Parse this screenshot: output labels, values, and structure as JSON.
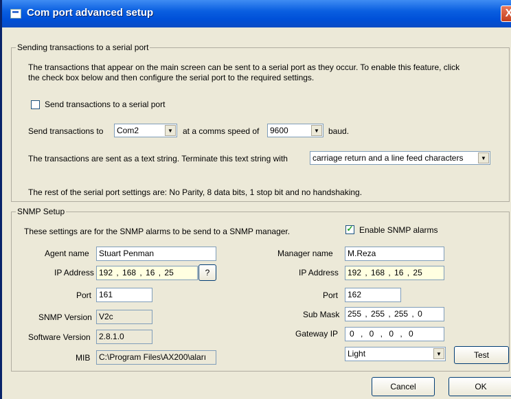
{
  "window": {
    "title": "Com port advanced setup",
    "close_glyph": "X"
  },
  "serial": {
    "legend": "Sending transactions to a serial port",
    "description_line1": "The transactions that appear on the main screen can be sent to a serial port as they occur. To enable this feature, click",
    "description_line2": "the check box below and then configure the serial port to the required settings.",
    "checkbox_label": "Send transactions to a serial port",
    "checkbox_checked": false,
    "send_to_label": "Send transactions to",
    "port_value": "Com2",
    "speed_label": "at a comms speed of",
    "speed_value": "9600",
    "baud_label": "baud.",
    "terminate_label": "The transactions are sent as a text string. Terminate this text string with",
    "terminate_value": "carriage return and a line feed characters",
    "rest_text": "The rest of the serial port settings are: No Parity, 8 data bits, 1 stop bit and no handshaking."
  },
  "snmp": {
    "legend": "SNMP Setup",
    "description": "These settings are for the SNMP alarms to be send to a SNMP manager.",
    "enable_label": "Enable SNMP alarms",
    "enable_checked": true,
    "agent_name_label": "Agent name",
    "agent_name_value": "Stuart Penman",
    "agent_ip_label": "IP Address",
    "agent_ip_value": "192 , 168 , 16 , 25",
    "ip_help_label": "?",
    "agent_port_label": "Port",
    "agent_port_value": "161",
    "snmp_version_label": "SNMP Version",
    "snmp_version_value": "V2c",
    "software_version_label": "Software Version",
    "software_version_value": "2.8.1.0",
    "mib_label": "MIB",
    "mib_value": "C:\\Program Files\\AX200\\aları",
    "manager_name_label": "Manager name",
    "manager_name_value": "M.Reza",
    "manager_ip_label": "IP Address",
    "manager_ip_value": "192 , 168 , 16 , 25",
    "manager_port_label": "Port",
    "manager_port_value": "162",
    "sub_mask_label": "Sub Mask",
    "sub_mask_value": "255 , 255 , 255 , 0",
    "gateway_label": "Gateway IP",
    "gateway_value": "0 , 0 , 0 , 0",
    "level_value": "Light",
    "test_label": "Test"
  },
  "footer": {
    "cancel_label": "Cancel",
    "ok_label": "OK"
  },
  "icons": {
    "dropdown": "dropdown-arrow-icon",
    "checkmark": "checkmark-icon",
    "app": "window-app-icon"
  }
}
